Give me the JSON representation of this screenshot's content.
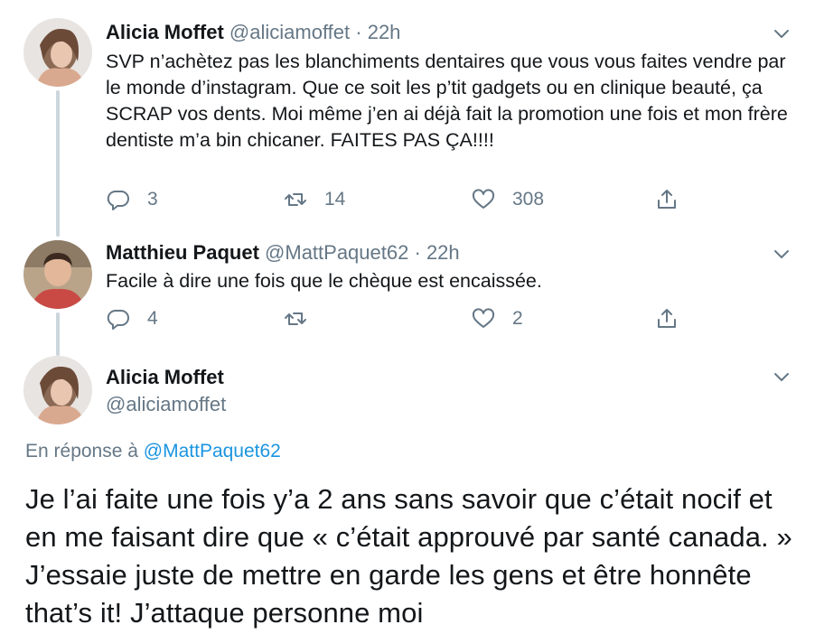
{
  "tweet1": {
    "name": "Alicia Moffet",
    "handle": "@aliciamoffet",
    "dot": "·",
    "time": "22h",
    "text": "SVP n’achètez pas les blanchiments dentaires que vous vous faites vendre par le monde d’instagram. Que ce soit les p’tit gadgets ou en clinique beauté, ça SCRAP vos dents. Moi même j’en ai déjà fait la promotion une fois et mon frère dentiste m’a bin chicaner. FAITES PAS ÇA!!!!",
    "replies": "3",
    "retweets": "14",
    "likes": "308"
  },
  "tweet2": {
    "name": "Matthieu Paquet",
    "handle": "@MattPaquet62",
    "dot": "·",
    "time": "22h",
    "text": "Facile à dire une fois que le chèque est encaissée.",
    "replies": "4",
    "retweets": "",
    "likes": "2"
  },
  "tweet3": {
    "name": "Alicia Moffet",
    "handle": "@aliciamoffet",
    "reply_prefix": "En réponse à",
    "reply_handle": "@MattPaquet62",
    "text": "Je l’ai faite une fois y’a 2 ans sans savoir que c’était nocif et en me faisant dire que «  c’était approuvé par santé canada. » J’essaie juste de mettre en garde les gens et être honnête that’s it! J’attaque personne moi"
  },
  "icons": [
    "reply-icon",
    "retweet-icon",
    "like-icon",
    "share-icon",
    "chevron-down-icon"
  ],
  "colors": {
    "text": "#14171a",
    "secondary": "#657786",
    "link": "#1b95e0",
    "thread": "#ccd6dd"
  }
}
